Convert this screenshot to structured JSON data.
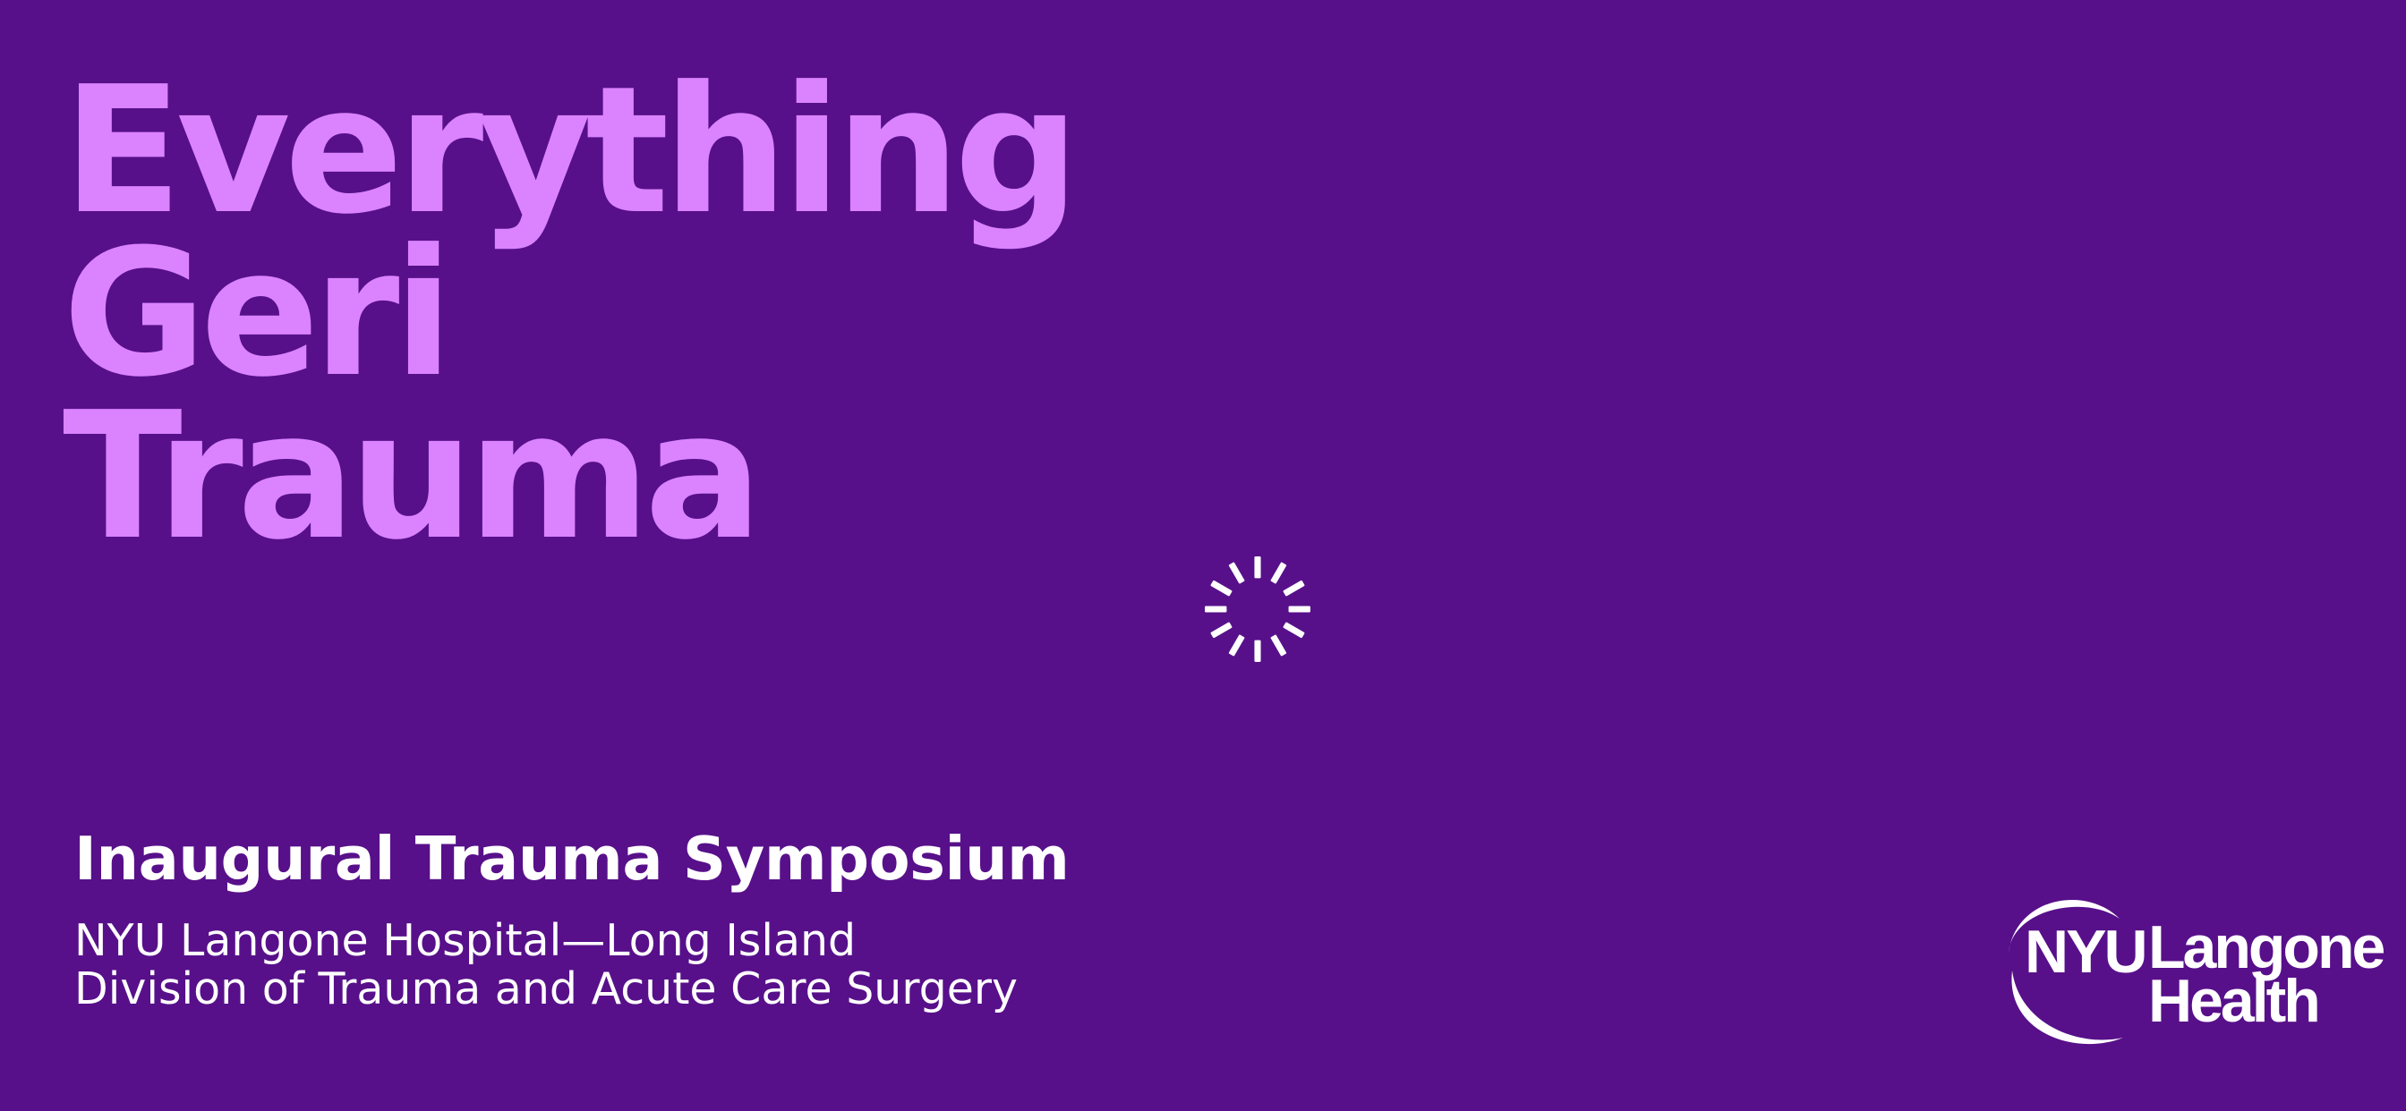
{
  "hero": {
    "title_lines": [
      "Everything",
      "Geri",
      "Trauma"
    ]
  },
  "event": {
    "name": "Inaugural Trauma Symposium",
    "host_line1": "NYU Langone Hospital—Long Island",
    "host_line2": "Division of Trauma and Acute Care Surgery"
  },
  "logo": {
    "mark_text": "NYU",
    "word_line1": "Langone",
    "word_line2": "Health"
  },
  "status": {
    "indicator": "loading-spinner-icon"
  },
  "colors": {
    "background": "#57108a",
    "title": "#db83ff",
    "text": "#ffffff"
  }
}
